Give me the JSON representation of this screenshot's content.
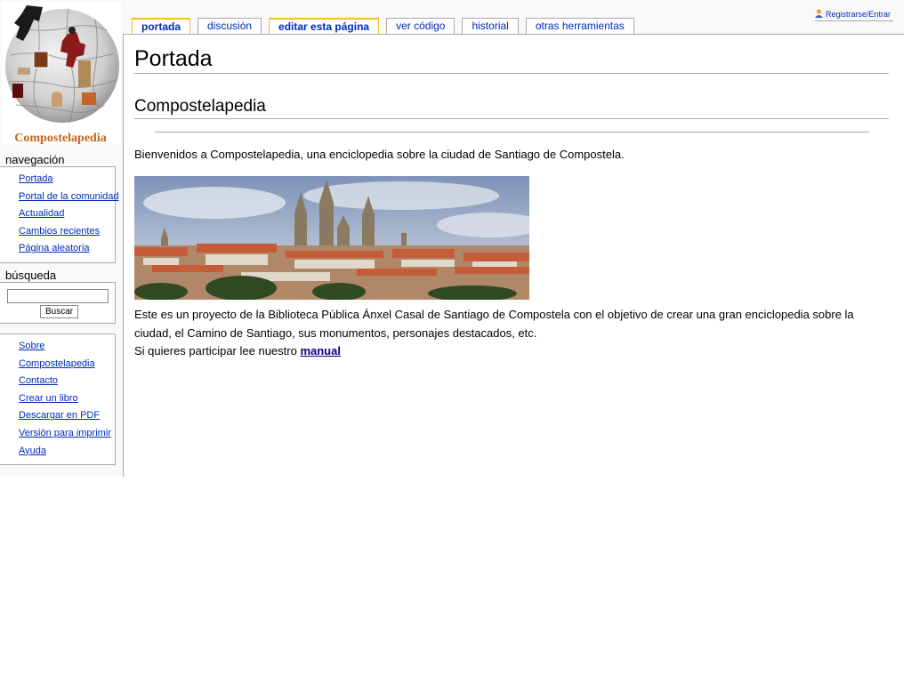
{
  "logo": {
    "text": "Compostelapedia"
  },
  "personal": {
    "login": "Registrarse/Entrar"
  },
  "tabs": [
    {
      "label": "portada",
      "state": "selected"
    },
    {
      "label": "discusión",
      "state": "normal"
    },
    {
      "label": "editar esta página",
      "state": "bold"
    },
    {
      "label": "ver código",
      "state": "normal"
    },
    {
      "label": "historial",
      "state": "normal"
    },
    {
      "label": "otras herramientas",
      "state": "normal"
    }
  ],
  "content": {
    "title": "Portada",
    "heading": "Compostelapedia",
    "intro": "Bienvenidos a Compostelapedia, una enciclopedia sobre la ciudad de Santiago de Compostela.",
    "description": "Este es un proyecto de la Biblioteca Pública Ánxel Casal de Santiago de Compostela con el objetivo de crear una gran enciclopedia sobre la ciudad, el Camino de Santiago, sus monumentos, personajes destacados, etc.",
    "participate_text": "Si quieres participar lee nuestro ",
    "manual_link": "manual"
  },
  "navigation": {
    "title": "navegación",
    "items": [
      "Portada",
      "Portal de la comunidad",
      "Actualidad",
      "Cambios recientes",
      "Página aleatoria"
    ]
  },
  "search": {
    "title": "búsqueda",
    "value": "",
    "button": "Buscar"
  },
  "toolbox": {
    "items": [
      "Sobre",
      "Compostelapedia",
      "Contacto",
      "Crear un libro",
      "Descargar en PDF",
      "Versión para imprimir",
      "Ayuda"
    ]
  },
  "colors": {
    "link": "#002bb8",
    "tab_highlight": "#fabd23",
    "border": "#aaaaaa"
  }
}
